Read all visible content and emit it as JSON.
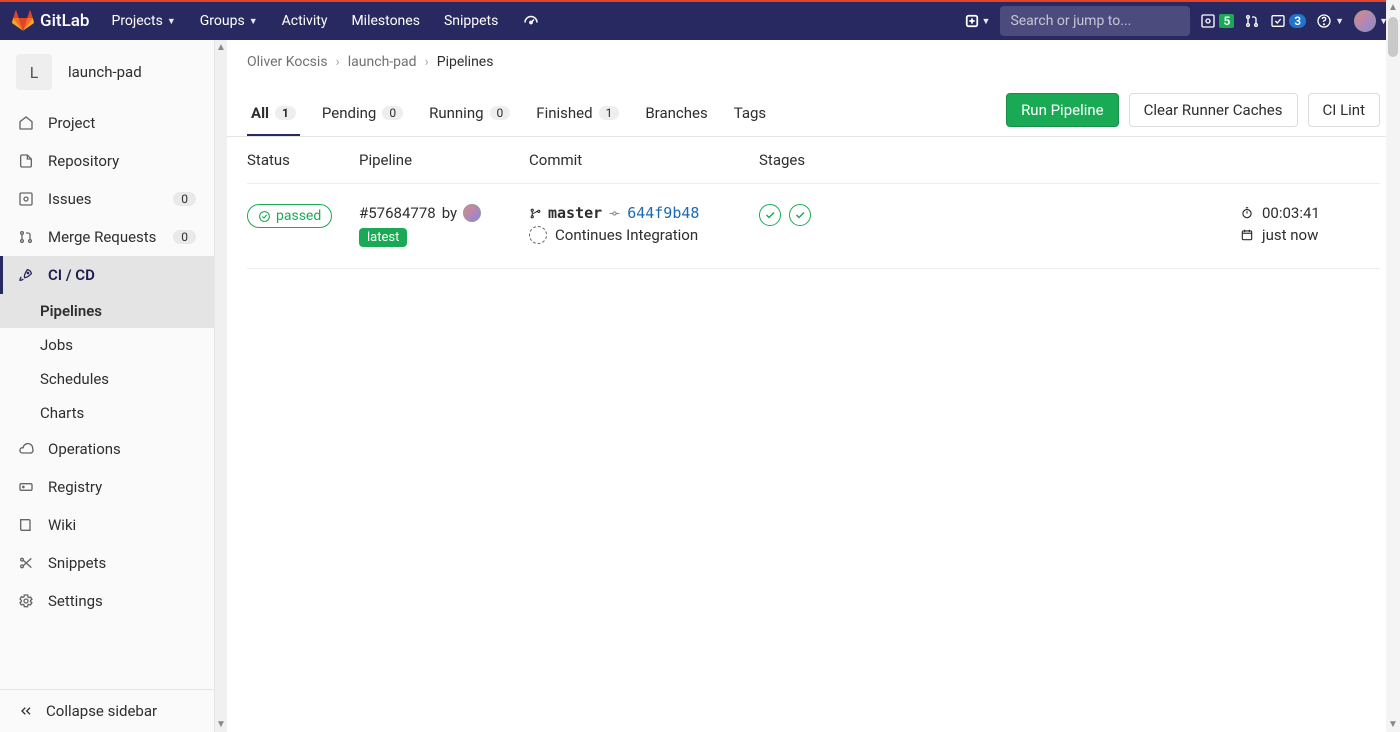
{
  "navbar": {
    "brand": "GitLab",
    "links": {
      "projects": "Projects",
      "groups": "Groups",
      "activity": "Activity",
      "milestones": "Milestones",
      "snippets": "Snippets"
    },
    "search_placeholder": "Search or jump to...",
    "issues_badge": "5",
    "todos_badge": "3"
  },
  "sidebar": {
    "project_initial": "L",
    "project_name": "launch-pad",
    "items": {
      "project": "Project",
      "repository": "Repository",
      "issues": "Issues",
      "issues_count": "0",
      "merge_requests": "Merge Requests",
      "mr_count": "0",
      "cicd": "CI / CD",
      "operations": "Operations",
      "registry": "Registry",
      "wiki": "Wiki",
      "snippets": "Snippets",
      "settings": "Settings"
    },
    "cicd_sub": {
      "pipelines": "Pipelines",
      "jobs": "Jobs",
      "schedules": "Schedules",
      "charts": "Charts"
    },
    "collapse": "Collapse sidebar"
  },
  "breadcrumbs": {
    "owner": "Oliver Kocsis",
    "project": "launch-pad",
    "page": "Pipelines"
  },
  "tabs": {
    "all": "All",
    "all_count": "1",
    "pending": "Pending",
    "pending_count": "0",
    "running": "Running",
    "running_count": "0",
    "finished": "Finished",
    "finished_count": "1",
    "branches": "Branches",
    "tags": "Tags"
  },
  "actions": {
    "run": "Run Pipeline",
    "clear": "Clear Runner Caches",
    "lint": "CI Lint"
  },
  "table": {
    "headers": {
      "status": "Status",
      "pipeline": "Pipeline",
      "commit": "Commit",
      "stages": "Stages"
    },
    "rows": [
      {
        "status": "passed",
        "latest": "latest",
        "pipeline_id": "#57684778",
        "by": "by",
        "branch": "master",
        "sha": "644f9b48",
        "commit_msg": "Continues Integration",
        "duration": "00:03:41",
        "when": "just now"
      }
    ]
  }
}
